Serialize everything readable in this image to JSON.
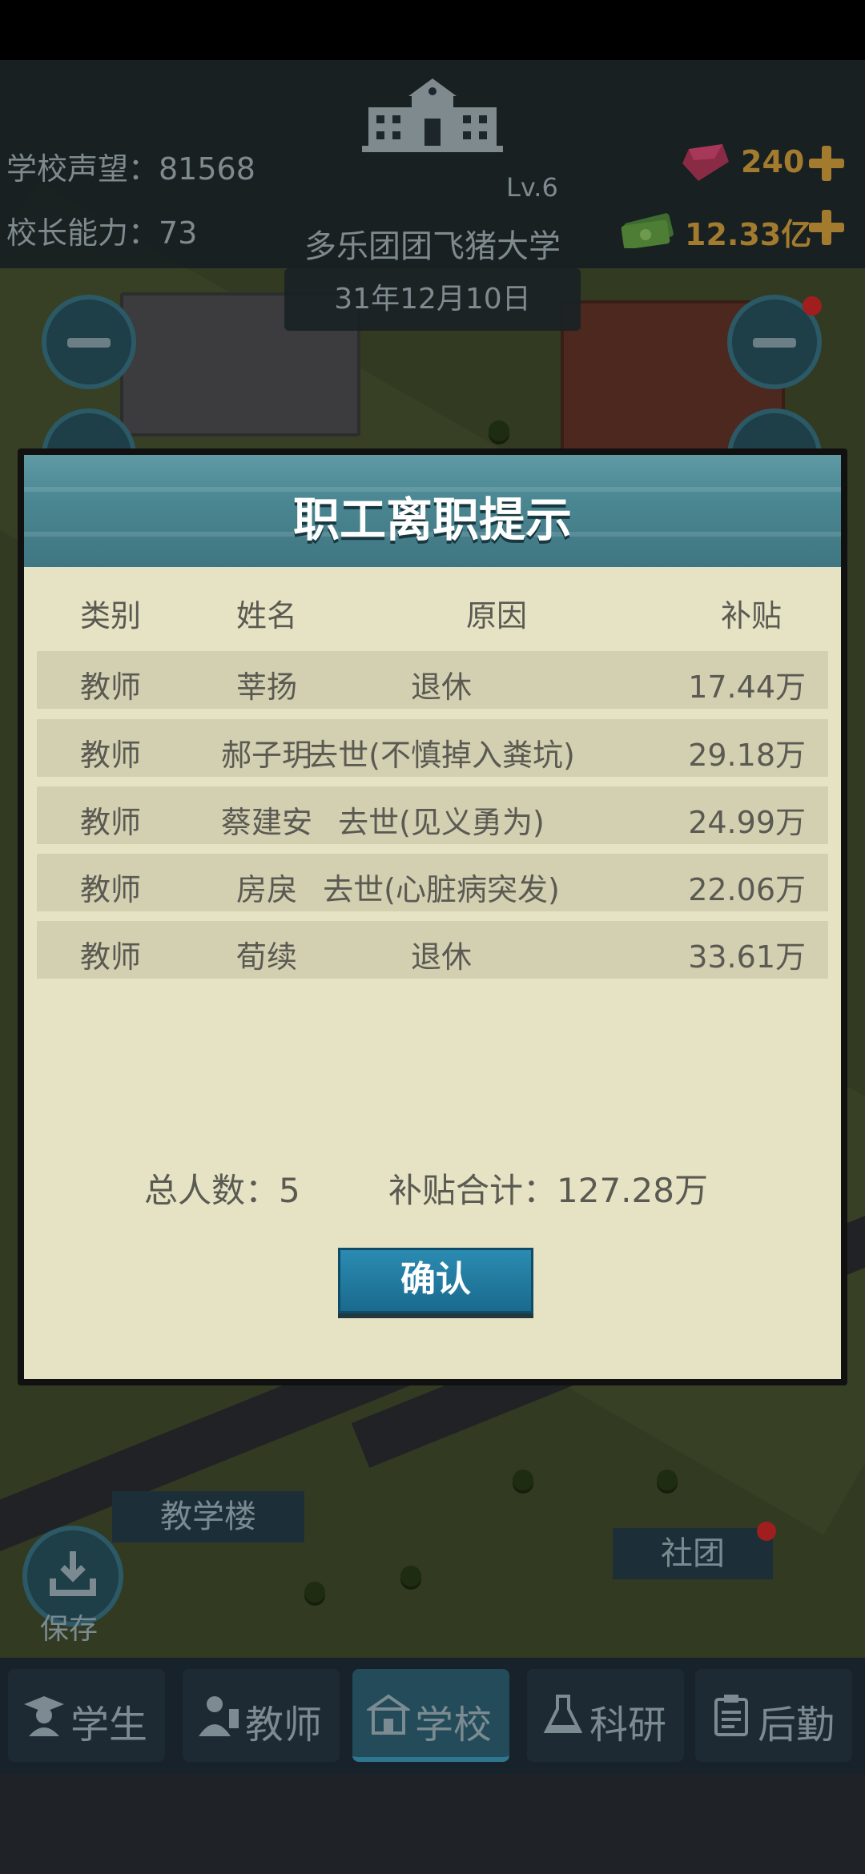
{
  "hud": {
    "reputation_label": "学校声望：81568",
    "ability_label": "校长能力：73",
    "level": "Lv.6",
    "school_name": "多乐团团飞猪大学",
    "date": "31年12月10日",
    "gems": "240",
    "money": "12.33亿"
  },
  "modal": {
    "title": "职工离职提示",
    "columns": [
      "类别",
      "姓名",
      "原因",
      "补贴"
    ],
    "rows": [
      {
        "type": "教师",
        "name": "莘扬",
        "reason": "退休",
        "subsidy": "17.44万"
      },
      {
        "type": "教师",
        "name": "郝子玥",
        "reason": "去世(不慎掉入粪坑)",
        "subsidy": "29.18万"
      },
      {
        "type": "教师",
        "name": "蔡建安",
        "reason": "去世(见义勇为)",
        "subsidy": "24.99万"
      },
      {
        "type": "教师",
        "name": "房戾",
        "reason": "去世(心脏病突发)",
        "subsidy": "22.06万"
      },
      {
        "type": "教师",
        "name": "荀续",
        "reason": "退休",
        "subsidy": "33.61万"
      }
    ],
    "total_count": "总人数：5",
    "total_subsidy": "补贴合计：127.28万",
    "confirm_label": "确认"
  },
  "map": {
    "label_teaching": "教学楼",
    "label_club": "社团",
    "save_label": "保存"
  },
  "nav": {
    "tabs": [
      {
        "label": "学生",
        "icon": "student-icon"
      },
      {
        "label": "教师",
        "icon": "teacher-icon"
      },
      {
        "label": "学校",
        "icon": "school-icon"
      },
      {
        "label": "科研",
        "icon": "flask-icon"
      },
      {
        "label": "后勤",
        "icon": "clipboard-icon"
      }
    ],
    "active_index": 2
  },
  "colors": {
    "modal_bg": "#e6e3c4",
    "header_teal": "#4a8792",
    "row_bg": "#d3cfb1",
    "confirm_blue": "#2b8bb1",
    "resource_gold": "#a27b2e",
    "alert_red": "#a01e1e"
  }
}
